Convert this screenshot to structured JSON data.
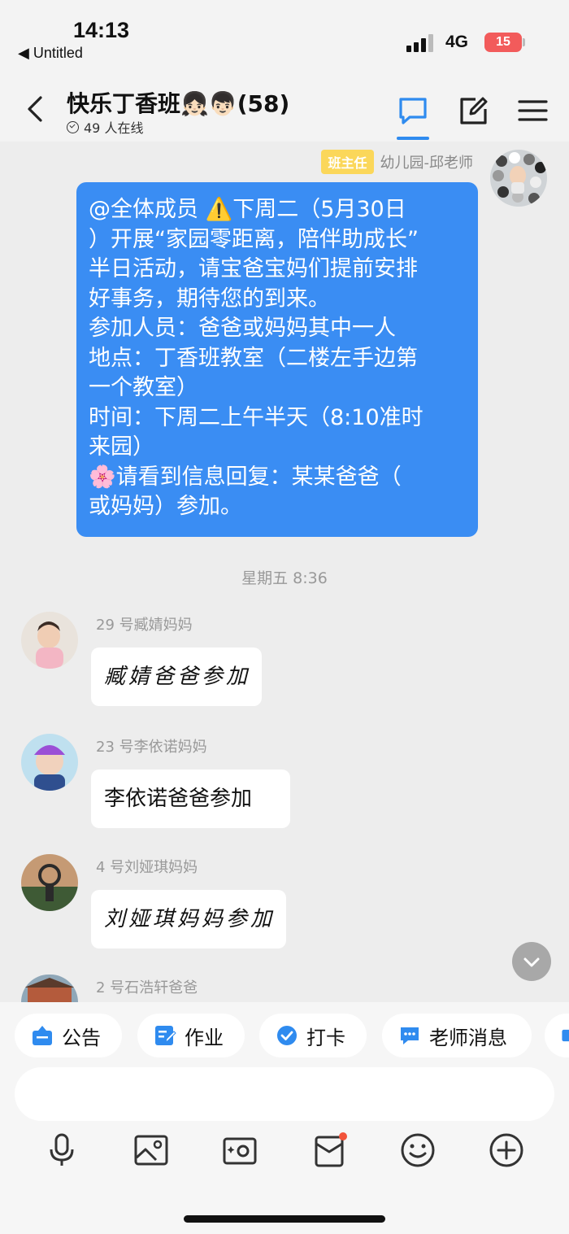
{
  "status_bar": {
    "time": "14:13",
    "back_app": "◀ Untitled",
    "network": "4G",
    "battery": "15"
  },
  "header": {
    "title": "快乐丁香班👧🏻👦🏻(58)",
    "online": "49 人在线"
  },
  "messages": {
    "teacher": {
      "role": "班主任",
      "name": "幼儿园-邱老师",
      "lines": [
        "@全体成员 ⚠️下周二（5月30日",
        "）开展“家园零距离，陪伴助成长”",
        "半日活动，请宝爸宝妈们提前安排",
        "好事务，期待您的到来。",
        "参加人员：爸爸或妈妈其中一人",
        "地点：丁香班教室（二楼左手边第",
        "一个教室）",
        "时间：下周二上午半天（8:10准时",
        "来园）",
        "🌸请看到信息回复：某某爸爸（",
        "或妈妈）参加。"
      ]
    },
    "timestamp": "星期五 8:36",
    "replies": [
      {
        "sender": "29 号臧婧妈妈",
        "text": "臧婧爸爸参加"
      },
      {
        "sender": "23 号李依诺妈妈",
        "text": "李依诺爸爸参加"
      },
      {
        "sender": "4 号刘娅琪妈妈",
        "text": "刘娅琪妈妈参加"
      },
      {
        "sender": "2 号石浩轩爸爸"
      }
    ]
  },
  "quick_bar": {
    "announcement": "公告",
    "homework": "作业",
    "checkin": "打卡",
    "teacher_msg": "老师消息"
  },
  "colors": {
    "accent": "#3a8df3",
    "badge": "#fbd75a",
    "notification_dot": "#f2533a",
    "battery": "#f25b5b"
  },
  "icons": [
    "back-chevron-icon",
    "chat-icon",
    "edit-icon",
    "menu-icon",
    "microphone-icon",
    "image-icon",
    "camera-icon",
    "red-packet-icon",
    "emoji-icon",
    "plus-icon"
  ]
}
